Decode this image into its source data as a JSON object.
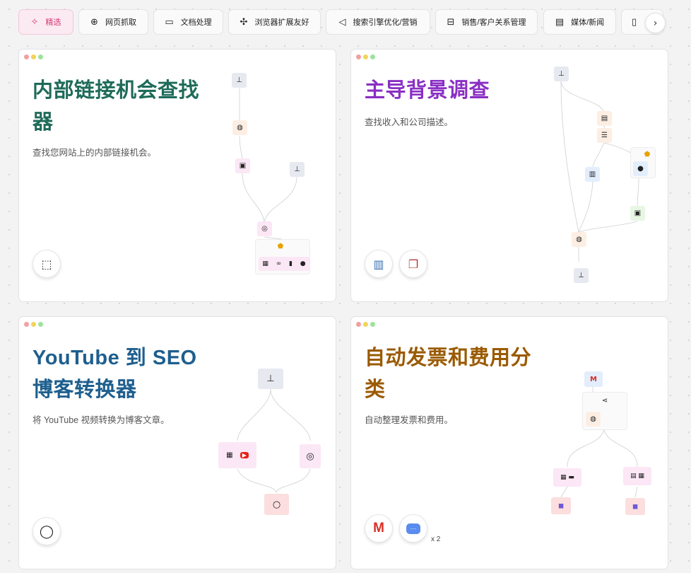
{
  "tabs": [
    {
      "label": "精选",
      "icon": "sparkle-icon",
      "active": true
    },
    {
      "label": "网页抓取",
      "icon": "globe-icon"
    },
    {
      "label": "文档处理",
      "icon": "document-icon"
    },
    {
      "label": "浏览器扩展友好",
      "icon": "puzzle-icon"
    },
    {
      "label": "搜索引擎优化/营销",
      "icon": "megaphone-icon"
    },
    {
      "label": "销售/客户关系管理",
      "icon": "briefcase-icon"
    },
    {
      "label": "媒体/新闻",
      "icon": "newspaper-icon"
    }
  ],
  "cards": [
    {
      "title": "内部链接机会查找器",
      "description": "查找您网站上的内部链接机会。",
      "title_color": "#1f6b5a",
      "apps": [
        "browser-cursor-icon"
      ]
    },
    {
      "title": "主导背景调查",
      "description": "查找收入和公司描述。",
      "title_color": "#8a2fc4",
      "apps": [
        "building-icon",
        "book-icon"
      ]
    },
    {
      "title": "YouTube 到 SEO 博客转换器",
      "description": "将 YouTube 视频转换为博客文章。",
      "title_color": "#1e5f8e",
      "apps": [
        "openai-icon"
      ]
    },
    {
      "title": "自动发票和费用分类",
      "description": "自动整理发票和费用。",
      "title_color": "#9a5a00",
      "apps": [
        "gmail-icon",
        "chat-bubble-icon"
      ],
      "apps_extra": "x 2"
    }
  ]
}
